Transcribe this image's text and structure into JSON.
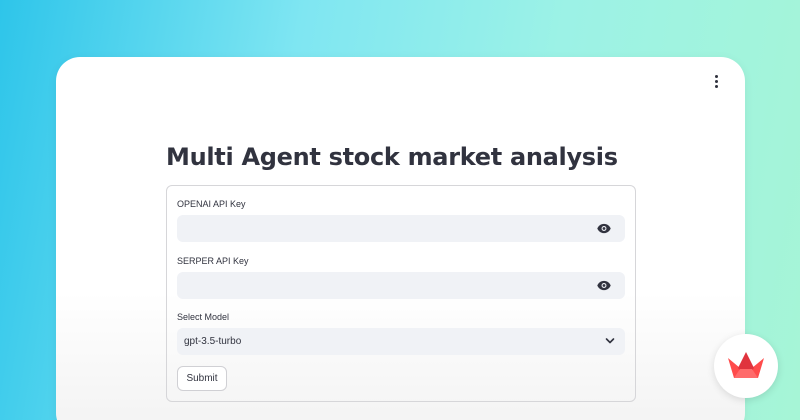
{
  "app": {
    "title": "Multi Agent stock market analysis"
  },
  "form": {
    "openai_key": {
      "label": "OPENAI API Key",
      "value": "",
      "placeholder": ""
    },
    "serper_key": {
      "label": "SERPER API Key",
      "value": "",
      "placeholder": ""
    },
    "model": {
      "label": "Select Model",
      "selected": "gpt-3.5-turbo"
    },
    "submit_label": "Submit"
  },
  "icons": {
    "menu": "vertical-ellipsis-icon",
    "password_toggle": "eye-icon",
    "select_toggle": "chevron-down-icon",
    "brand": "streamlit-logo"
  },
  "colors": {
    "text": "#31333f",
    "input_bg": "#f0f2f6",
    "brand_red": "#ff4b4b"
  }
}
